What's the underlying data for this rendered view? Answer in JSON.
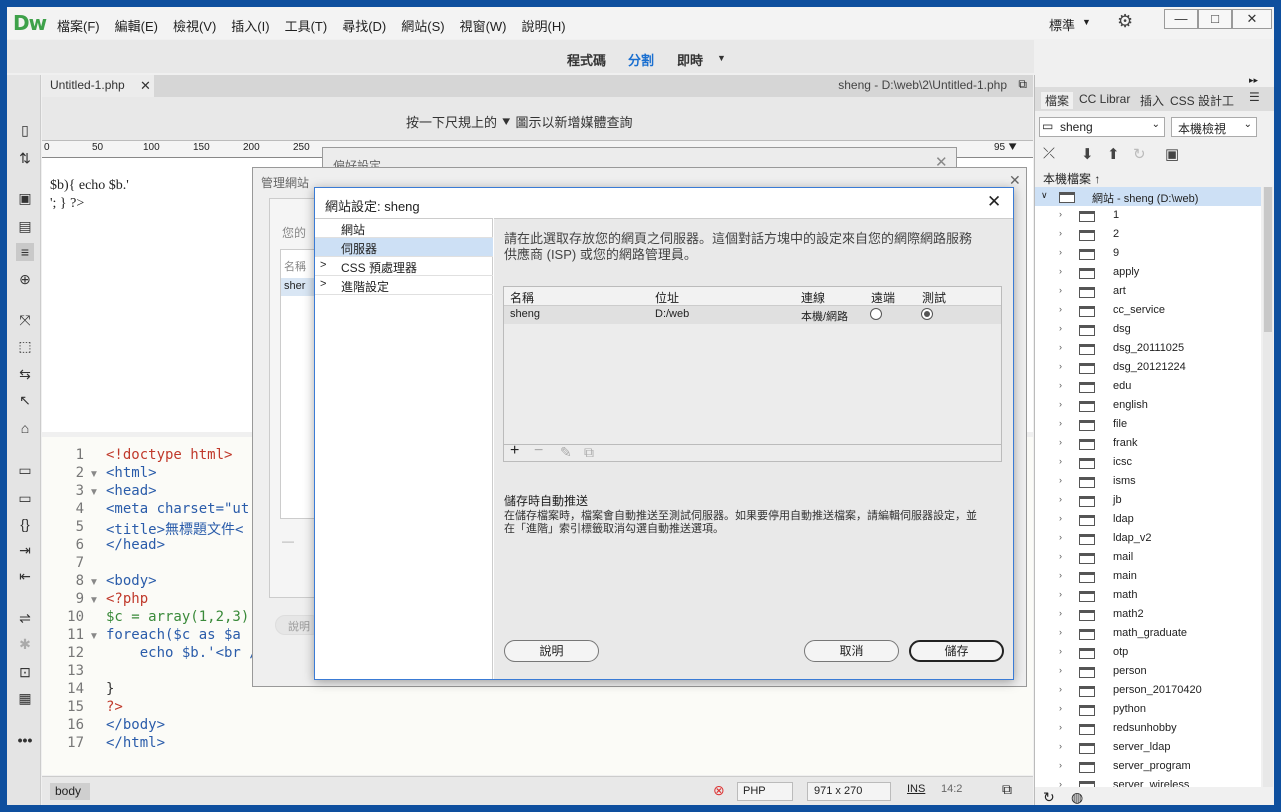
{
  "app": {
    "logo": "Dw",
    "menu": [
      "檔案(F)",
      "編輯(E)",
      "檢視(V)",
      "插入(I)",
      "工具(T)",
      "尋找(D)",
      "網站(S)",
      "視窗(W)",
      "說明(H)"
    ],
    "workspace": "標準",
    "win_min": "—",
    "win_max": "□",
    "win_close": "✕"
  },
  "viewbar": {
    "code": "程式碼",
    "split": "分割",
    "live": "即時",
    "more": "▼"
  },
  "doc": {
    "tab": "Untitled-1.php",
    "path": "sheng - D:\\web\\2\\Untitled-1.php",
    "mq_hint": "按一下尺規上的",
    "mq_hint2": "圖示以新增媒體查詢",
    "ruler_ticks": [
      "0",
      "50",
      "100",
      "150",
      "200",
      "250",
      "95"
    ],
    "design_lines": [
      "$b){ echo $b.'",
      "'; } ?>"
    ]
  },
  "code_lines": [
    {
      "n": "1",
      "fold": "",
      "text": "<!doctype html>",
      "color": "#c0392b"
    },
    {
      "n": "2",
      "fold": "▼",
      "text": "<html>",
      "color": "#2a5caa"
    },
    {
      "n": "3",
      "fold": "▼",
      "text": "<head>",
      "color": "#2a5caa"
    },
    {
      "n": "4",
      "fold": "",
      "text": "<meta charset=\"ut",
      "color": "#2a5caa"
    },
    {
      "n": "5",
      "fold": "",
      "text": "<title>無標題文件<",
      "color": "#2a5caa"
    },
    {
      "n": "6",
      "fold": "",
      "text": "</head>",
      "color": "#2a5caa"
    },
    {
      "n": "7",
      "fold": "",
      "text": "",
      "color": "#333"
    },
    {
      "n": "8",
      "fold": "▼",
      "text": "<body>",
      "color": "#2a5caa"
    },
    {
      "n": "9",
      "fold": "▼",
      "text": "<?php",
      "color": "#c0392b"
    },
    {
      "n": "10",
      "fold": "",
      "text": "$c = array(1,2,3)",
      "color": "#3a8a3a"
    },
    {
      "n": "11",
      "fold": "▼",
      "text": "foreach($c as $a",
      "color": "#2a5caa"
    },
    {
      "n": "12",
      "fold": "",
      "text": "    echo $b.'<br />';",
      "color": "#2a5caa"
    },
    {
      "n": "13",
      "fold": "",
      "text": "",
      "color": "#333"
    },
    {
      "n": "14",
      "fold": "",
      "text": "}",
      "color": "#333"
    },
    {
      "n": "15",
      "fold": "",
      "text": "?>",
      "color": "#c0392b"
    },
    {
      "n": "16",
      "fold": "",
      "text": "</body>",
      "color": "#2a5caa"
    },
    {
      "n": "17",
      "fold": "",
      "text": "</html>",
      "color": "#2a5caa"
    }
  ],
  "status": {
    "tag": "body",
    "lang": "PHP",
    "size": "971 x 270",
    "ins": "INS",
    "pos": "14:2"
  },
  "panel": {
    "tabs": [
      "檔案",
      "CC Librar",
      "插入",
      "CSS 設計工"
    ],
    "site": "sheng",
    "view": "本機檢視",
    "local_files": "本機檔案 ↑",
    "root": "網站 - sheng (D:\\web)",
    "folders": [
      "1",
      "2",
      "9",
      "apply",
      "art",
      "cc_service",
      "dsg",
      "dsg_20111025",
      "dsg_20121224",
      "edu",
      "english",
      "file",
      "frank",
      "icsc",
      "isms",
      "jb",
      "ldap",
      "ldap_v2",
      "mail",
      "main",
      "math",
      "math2",
      "math_graduate",
      "otp",
      "person",
      "person_20170420",
      "python",
      "redsunhobby",
      "server_ldap",
      "server_program",
      "server_wireless"
    ]
  },
  "bg_dialogs": {
    "pref_title": "偏好設定",
    "manage_title": "管理網站",
    "manage_your": "您的",
    "manage_name": "名稱",
    "manage_site": "sher",
    "manage_help": "說明"
  },
  "dialog": {
    "title": "網站設定: sheng",
    "categories": [
      {
        "label": "網站",
        "arrow": ""
      },
      {
        "label": "伺服器",
        "arrow": ""
      },
      {
        "label": "CSS 預處理器",
        "arrow": ">"
      },
      {
        "label": "進階設定",
        "arrow": ">"
      }
    ],
    "description": "請在此選取存放您的網頁之伺服器。這個對話方塊中的設定來自您的網際網路服務供應商 (ISP) 或您的網路管理員。",
    "columns": [
      "名稱",
      "位址",
      "連線",
      "遠端",
      "測試"
    ],
    "row": {
      "name": "sheng",
      "address": "D:/web",
      "connection": "本機/網路"
    },
    "push_heading": "儲存時自動推送",
    "push_text": "在儲存檔案時，檔案會自動推送至測試伺服器。如果要停用自動推送檔案，請編輯伺服器設定，並在「進階」索引標籤取消勾選自動推送選項。",
    "help": "說明",
    "cancel": "取消",
    "save": "儲存"
  }
}
